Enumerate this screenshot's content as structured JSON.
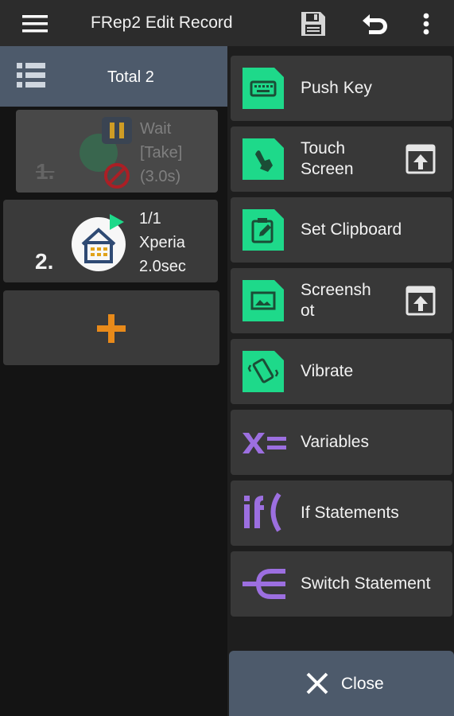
{
  "appbar": {
    "title": "FRep2 Edit Record",
    "icons": [
      "menu-icon",
      "save-icon",
      "undo-icon",
      "overflow-icon"
    ]
  },
  "left": {
    "total_label": "Total 2",
    "records": [
      {
        "number": "1.",
        "lines": [
          "Wait",
          "[Take]",
          "(3.0s)"
        ],
        "state": "disabled"
      },
      {
        "number": "2.",
        "lines": [
          "1/1",
          "Xperia",
          "2.0sec"
        ],
        "state": "enabled"
      }
    ],
    "add_icon": "plus-icon"
  },
  "actions": [
    {
      "label": "Push Key",
      "icon": "keyboard-icon"
    },
    {
      "label_lines": [
        "Touch",
        "Screen"
      ],
      "icon": "touch-icon",
      "extra_icon": "open-in-icon"
    },
    {
      "label": "Set Clipboard",
      "icon": "clipboard-icon"
    },
    {
      "label_lines": [
        "Screensh",
        "ot"
      ],
      "icon": "screenshot-icon",
      "extra_icon": "open-in-icon"
    },
    {
      "label": "Vibrate",
      "icon": "vibrate-icon"
    },
    {
      "label": "Variables",
      "icon": "variables-icon"
    },
    {
      "label": "If Statements",
      "icon": "if-icon"
    },
    {
      "label": "Switch Statement",
      "icon": "switch-icon"
    }
  ],
  "close": {
    "label": "Close"
  },
  "colors": {
    "accent_green": "#1ed98a",
    "accent_purple": "#9c6fe0",
    "accent_orange": "#e88a1a",
    "bar_blue_gray": "#4d5a6b"
  }
}
